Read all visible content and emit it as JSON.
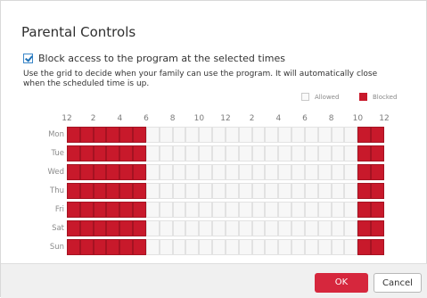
{
  "dialog": {
    "title": "Parental Controls",
    "checkbox_label": "Block access to the program at the selected times",
    "checkbox_checked": true,
    "description": "Use the grid to decide when your family can use the program. It will automatically close when the scheduled time is up."
  },
  "legend": {
    "allowed": "Allowed",
    "blocked": "Blocked",
    "allowed_color": "#fafafa",
    "blocked_color": "#c8192b"
  },
  "grid": {
    "hour_labels": [
      "12",
      "2",
      "4",
      "6",
      "8",
      "10",
      "12",
      "2",
      "4",
      "6",
      "8",
      "10",
      "12"
    ],
    "days": [
      {
        "name": "Mon",
        "blocked": [
          0,
          1,
          2,
          3,
          4,
          5,
          22,
          23
        ]
      },
      {
        "name": "Tue",
        "blocked": [
          0,
          1,
          2,
          3,
          4,
          5,
          22,
          23
        ]
      },
      {
        "name": "Wed",
        "blocked": [
          0,
          1,
          2,
          3,
          4,
          5,
          22,
          23
        ]
      },
      {
        "name": "Thu",
        "blocked": [
          0,
          1,
          2,
          3,
          4,
          5,
          22,
          23
        ]
      },
      {
        "name": "Fri",
        "blocked": [
          0,
          1,
          2,
          3,
          4,
          5,
          22,
          23
        ]
      },
      {
        "name": "Sat",
        "blocked": [
          0,
          1,
          2,
          3,
          4,
          5,
          22,
          23
        ]
      },
      {
        "name": "Sun",
        "blocked": [
          0,
          1,
          2,
          3,
          4,
          5,
          22,
          23
        ]
      }
    ],
    "hours_per_day": 24
  },
  "footer": {
    "ok_label": "OK",
    "cancel_label": "Cancel"
  }
}
